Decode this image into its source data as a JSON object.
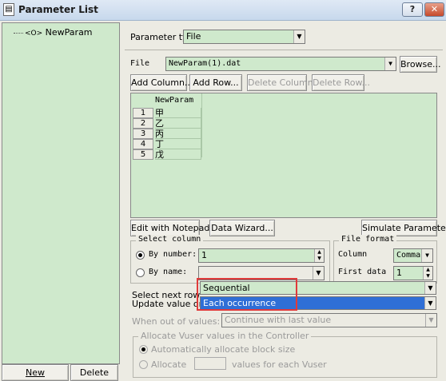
{
  "window": {
    "title": "Parameter List",
    "help_label": "?",
    "close_label": "✕",
    "icon": "document-icon"
  },
  "tree": {
    "items": [
      {
        "label": "NewParam",
        "icon": "parameter-icon"
      }
    ]
  },
  "left_buttons": {
    "new_label": "New",
    "delete_label": "Delete"
  },
  "param_type": {
    "label": "Parameter type:",
    "value": "File"
  },
  "file": {
    "label": "File",
    "value": "NewParam(1).dat",
    "browse_label": "Browse..."
  },
  "toolbar": {
    "add_column": "Add Column...",
    "add_row": "Add Row...",
    "delete_column": "Delete Column...",
    "delete_row": "Delete Row..."
  },
  "grid": {
    "column_header": "NewParam",
    "rows": [
      {
        "num": "1",
        "value": "甲"
      },
      {
        "num": "2",
        "value": "乙"
      },
      {
        "num": "3",
        "value": "丙"
      },
      {
        "num": "4",
        "value": "丁"
      },
      {
        "num": "5",
        "value": "戊"
      }
    ]
  },
  "grid_buttons": {
    "edit_notepad": "Edit with Notepad...",
    "data_wizard": "Data Wizard...",
    "simulate": "Simulate Parameter..."
  },
  "select_column": {
    "title": "Select column",
    "by_number_label": "By number:",
    "by_number_value": "1",
    "by_number_selected": true,
    "by_name_label": "By name:",
    "by_name_value": ""
  },
  "file_format": {
    "title": "File format",
    "column_label": "Column",
    "column_value": "Comma",
    "first_data_label": "First data",
    "first_data_value": "1"
  },
  "select_next_row": {
    "label": "Select next row:",
    "value": "Sequential"
  },
  "update_value_on": {
    "label": "Update value on:",
    "value": "Each occurrence"
  },
  "when_out_of_values": {
    "label": "When out of values:",
    "value": "Continue with last value"
  },
  "allocate": {
    "title": "Allocate Vuser values in the Controller",
    "auto_label": "Automatically allocate block size",
    "manual_label": "Allocate",
    "manual_value": "",
    "manual_suffix": "values for each Vuser"
  },
  "highlight_color": "#e03a3a",
  "selection_color": "#2f6fd6"
}
